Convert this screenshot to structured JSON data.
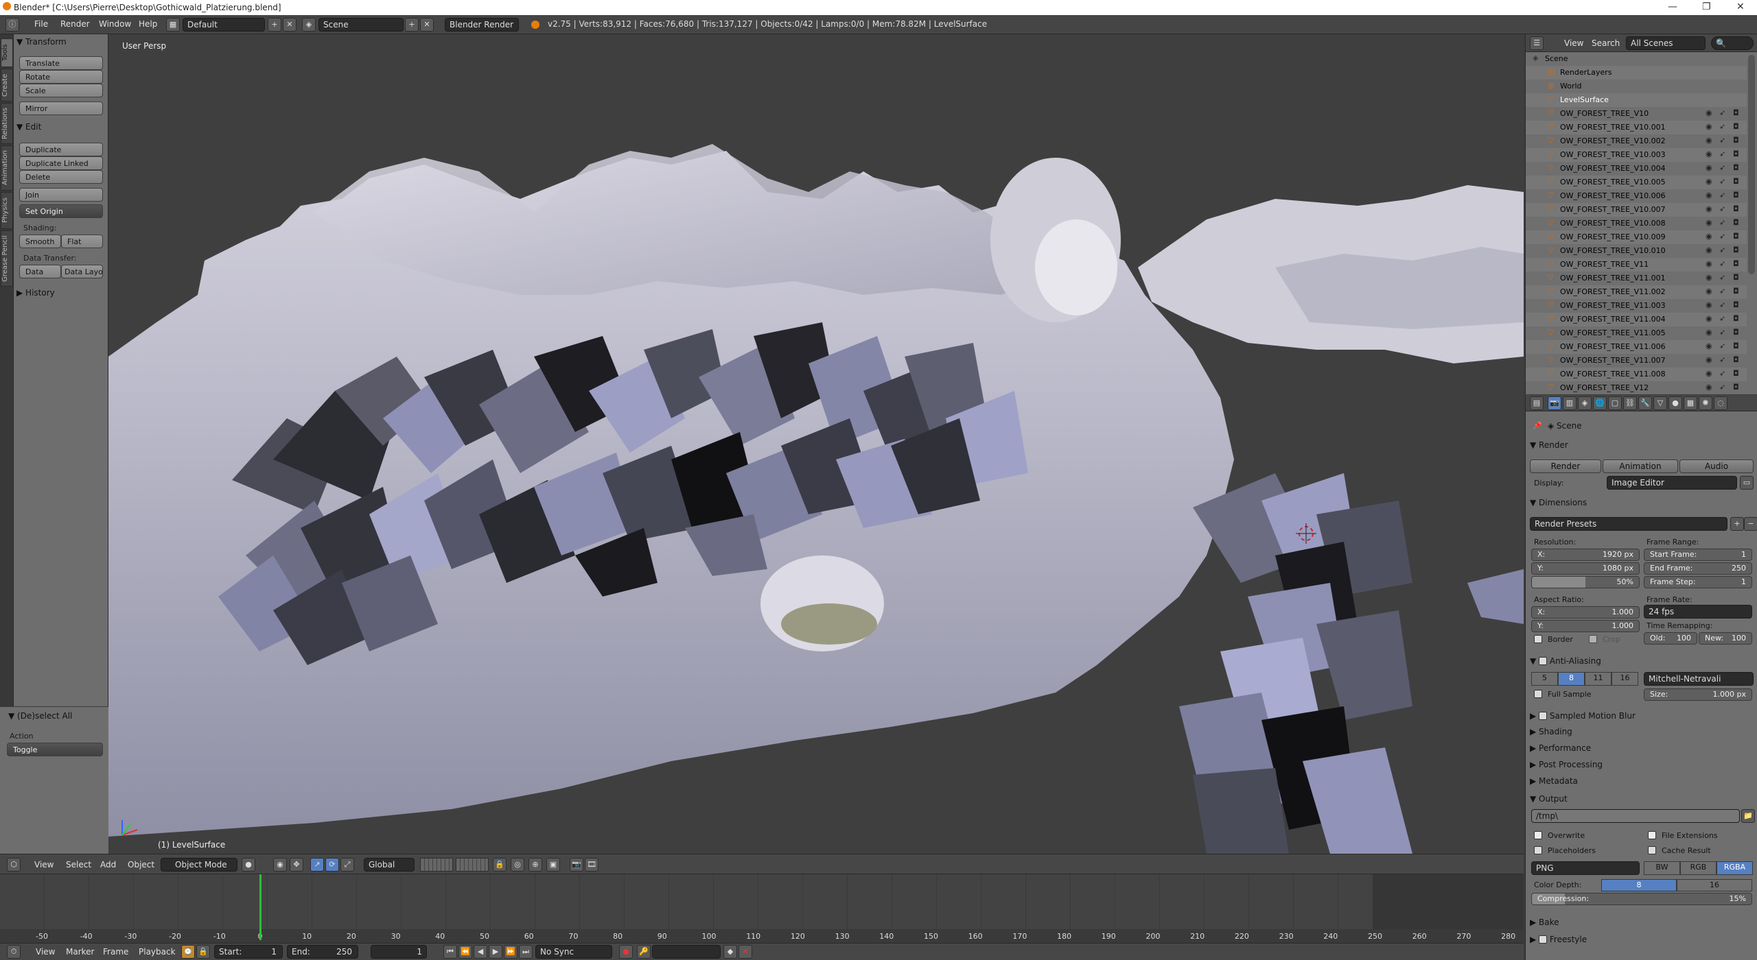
{
  "window": {
    "title": "Blender* [C:\\Users\\Pierre\\Desktop\\Gothicwald_Platzierung.blend]",
    "minimize": "—",
    "maximize": "❐",
    "close": "✕"
  },
  "infobar": {
    "menus": [
      "File",
      "Render",
      "Window",
      "Help"
    ],
    "layout": "Default",
    "scene": "Scene",
    "engine": "Blender Render",
    "stats": "v2.75 | Verts:83,912 | Faces:76,680 | Tris:137,127 | Objects:0/42 | Lamps:0/0 | Mem:78.82M | LevelSurface"
  },
  "left_tabs": [
    "Tools",
    "Create",
    "Relations",
    "Animation",
    "Physics",
    "Grease Pencil"
  ],
  "toolshelf": {
    "transform_header": "Transform",
    "translate": "Translate",
    "rotate": "Rotate",
    "scale": "Scale",
    "mirror": "Mirror",
    "edit_header": "Edit",
    "duplicate": "Duplicate",
    "duplicate_linked": "Duplicate Linked",
    "delete": "Delete",
    "join": "Join",
    "set_origin": "Set Origin",
    "shading_label": "Shading:",
    "smooth": "Smooth",
    "flat": "Flat",
    "data_transfer_label": "Data Transfer:",
    "data": "Data",
    "data_layout": "Data Layo",
    "history_header": "History",
    "operator_header": "(De)select All",
    "action_label": "Action",
    "action_value": "Toggle"
  },
  "viewport": {
    "view_name": "User Persp",
    "object_label": "(1) LevelSurface"
  },
  "vp_header": {
    "menus": [
      "View",
      "Select",
      "Add",
      "Object"
    ],
    "mode": "Object Mode",
    "orientation": "Global"
  },
  "timeline": {
    "ticks": [
      "-50",
      "-40",
      "-30",
      "-20",
      "-10",
      "0",
      "10",
      "20",
      "30",
      "40",
      "50",
      "60",
      "70",
      "80",
      "90",
      "100",
      "110",
      "120",
      "130",
      "140",
      "150",
      "160",
      "170",
      "180",
      "190",
      "200",
      "210",
      "220",
      "230",
      "240",
      "250",
      "260",
      "270",
      "280"
    ],
    "current_frame_value": 0,
    "menus": [
      "View",
      "Marker",
      "Frame",
      "Playback"
    ],
    "start_label": "Start:",
    "start_value": "1",
    "end_label": "End:",
    "end_value": "250",
    "frame_value": "1",
    "sync": "No Sync"
  },
  "outliner": {
    "menus": [
      "View",
      "Search"
    ],
    "filter": "All Scenes",
    "rows": [
      "Scene",
      "RenderLayers",
      "World",
      "LevelSurface",
      "OW_FOREST_TREE_V10",
      "OW_FOREST_TREE_V10.001",
      "OW_FOREST_TREE_V10.002",
      "OW_FOREST_TREE_V10.003",
      "OW_FOREST_TREE_V10.004",
      "OW_FOREST_TREE_V10.005",
      "OW_FOREST_TREE_V10.006",
      "OW_FOREST_TREE_V10.007",
      "OW_FOREST_TREE_V10.008",
      "OW_FOREST_TREE_V10.009",
      "OW_FOREST_TREE_V10.010",
      "OW_FOREST_TREE_V11",
      "OW_FOREST_TREE_V11.001",
      "OW_FOREST_TREE_V11.002",
      "OW_FOREST_TREE_V11.003",
      "OW_FOREST_TREE_V11.004",
      "OW_FOREST_TREE_V11.005",
      "OW_FOREST_TREE_V11.006",
      "OW_FOREST_TREE_V11.007",
      "OW_FOREST_TREE_V11.008",
      "OW_FOREST_TREE_V12"
    ]
  },
  "properties": {
    "context": "Scene",
    "render_header": "Render",
    "render_btn": "Render",
    "animation_btn": "Animation",
    "audio_btn": "Audio",
    "display_label": "Display:",
    "display_value": "Image Editor",
    "dimensions_header": "Dimensions",
    "render_presets": "Render Presets",
    "resolution_label": "Resolution:",
    "res_x_label": "X:",
    "res_x": "1920 px",
    "res_y_label": "Y:",
    "res_y": "1080 px",
    "res_pct": "50%",
    "res_pct_value": 50,
    "frame_range_label": "Frame Range:",
    "start_frame_label": "Start Frame:",
    "start_frame": "1",
    "end_frame_label": "End Frame:",
    "end_frame": "250",
    "frame_step_label": "Frame Step:",
    "frame_step": "1",
    "aspect_label": "Aspect Ratio:",
    "aspect_x_label": "X:",
    "aspect_x": "1.000",
    "aspect_y_label": "Y:",
    "aspect_y": "1.000",
    "frame_rate_label": "Frame Rate:",
    "frame_rate": "24 fps",
    "time_remap_label": "Time Remapping:",
    "old_label": "Old:",
    "old_value": "100",
    "new_label": "New:",
    "new_value": "100",
    "border_label": "Border",
    "crop_label": "Crop",
    "aa_header": "Anti-Aliasing",
    "aa_samples": [
      "5",
      "8",
      "11",
      "16"
    ],
    "aa_selected": "8",
    "aa_filter": "Mitchell-Netravali",
    "full_sample": "Full Sample",
    "size_label": "Size:",
    "size_value": "1.000 px",
    "collapsed_sections": [
      "Sampled Motion Blur",
      "Shading",
      "Performance",
      "Post Processing",
      "Metadata"
    ],
    "output_header": "Output",
    "output_path": "/tmp\\",
    "overwrite": "Overwrite",
    "file_extensions": "File Extensions",
    "placeholders": "Placeholders",
    "cache_result": "Cache Result",
    "file_format": "PNG",
    "color_modes": [
      "BW",
      "RGB",
      "RGBA"
    ],
    "color_mode_selected": "RGBA",
    "color_depth_label": "Color Depth:",
    "color_depths": [
      "8",
      "16"
    ],
    "color_depth_selected": "8",
    "compression_label": "Compression:",
    "compression": "15%",
    "compression_value": 15,
    "bake_header": "Bake",
    "freestyle_header": "Freestyle"
  },
  "colors": {
    "accent": "#5680c2",
    "active_frame": "#2fbf3a",
    "viewport_bg": "#3f3f3f",
    "panel_bg": "#6e6e6e"
  }
}
